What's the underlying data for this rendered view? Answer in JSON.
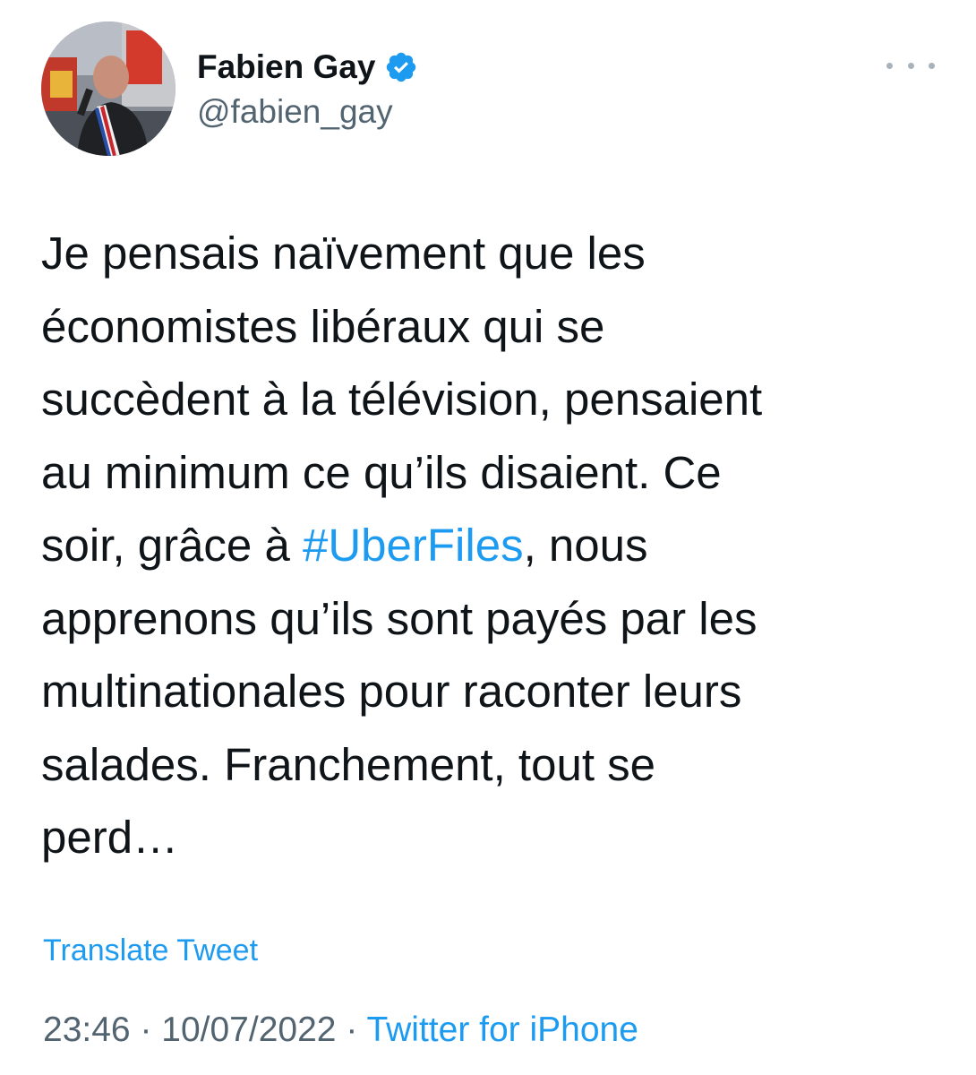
{
  "author": {
    "display_name": "Fabien Gay",
    "handle": "@fabien_gay",
    "verified": true,
    "verified_color": "#1d9bf0",
    "avatar_icon": "profile-photo"
  },
  "menu": {
    "icon": "more-horizontal-icon"
  },
  "tweet": {
    "lines": [
      "Je pensais naïvement que les",
      "économistes libéraux qui se",
      "succèdent à la télévision, pensaient",
      "au minimum ce qu’ils disaient. Ce",
      "apprenons qu’ils sont payés par les",
      "multinationales pour raconter leurs",
      "salades. Franchement, tout se",
      "perd…"
    ],
    "line5_before": "soir, grâce à ",
    "hashtag": "#UberFiles",
    "line5_after": ", nous"
  },
  "translate_label": "Translate Tweet",
  "meta": {
    "time": "23:46",
    "separator": " · ",
    "date": "10/07/2022",
    "source": "Twitter for iPhone"
  },
  "colors": {
    "text": "#0f1419",
    "secondary": "#536471",
    "link": "#1d9bf0"
  }
}
